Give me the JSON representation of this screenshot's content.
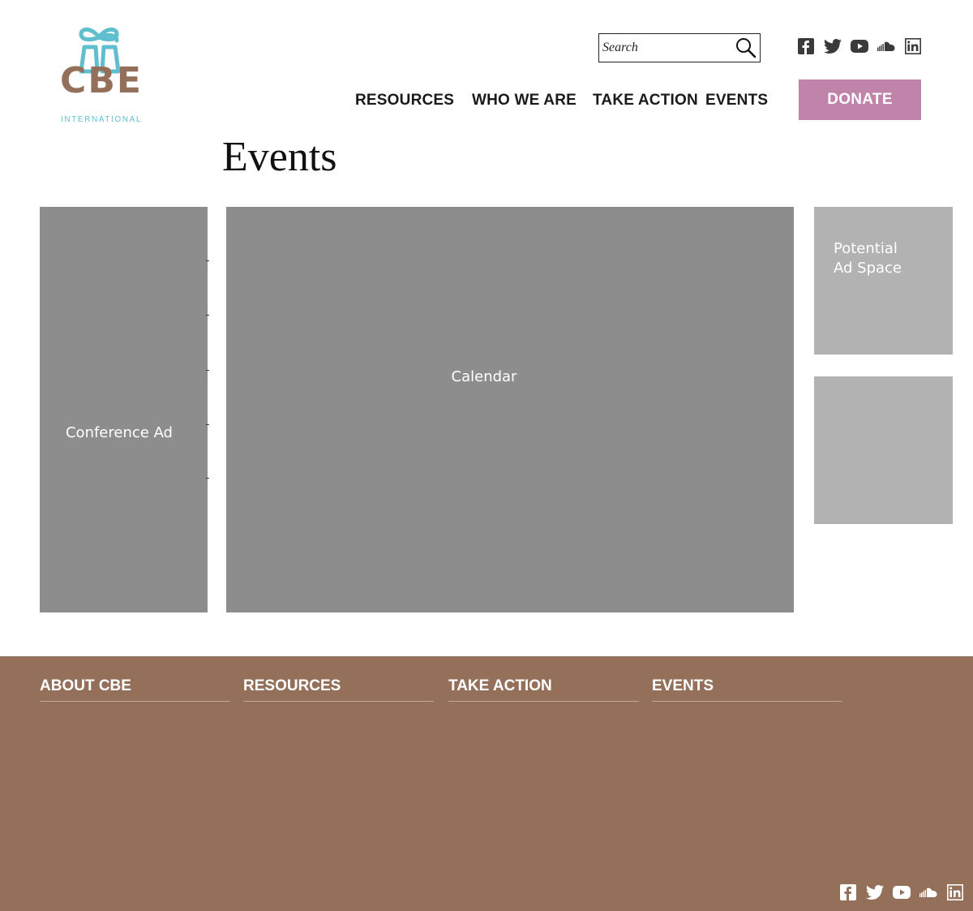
{
  "logo": {
    "wordmark": "CBE",
    "subtitle": "INTERNATIONAL"
  },
  "search": {
    "placeholder": "Search"
  },
  "social": [
    "facebook-icon",
    "twitter-icon",
    "youtube-icon",
    "soundcloud-icon",
    "linkedin-icon"
  ],
  "nav": {
    "resources": "RESOURCES",
    "who_we_are": "WHO WE ARE",
    "take_action": "TAKE ACTION",
    "events": "EVENTS"
  },
  "donate_label": "DONATE",
  "page_title": "Events",
  "blocks": {
    "conference_ad": "Conference Ad",
    "calendar": "Calendar",
    "ad_space_line1": "Potential",
    "ad_space_line2": "Ad Space"
  },
  "footer": {
    "about": "ABOUT CBE",
    "resources": "RESOURCES",
    "take_action": "TAKE ACTION",
    "events": "EVENTS"
  },
  "colors": {
    "logo_teal": "#5fbfcf",
    "logo_brown": "#94705b",
    "donate": "#c083a9",
    "footer_bg": "#94705b",
    "placeholder_dark": "#8d8d8d",
    "placeholder_light": "#b2b2b2"
  }
}
